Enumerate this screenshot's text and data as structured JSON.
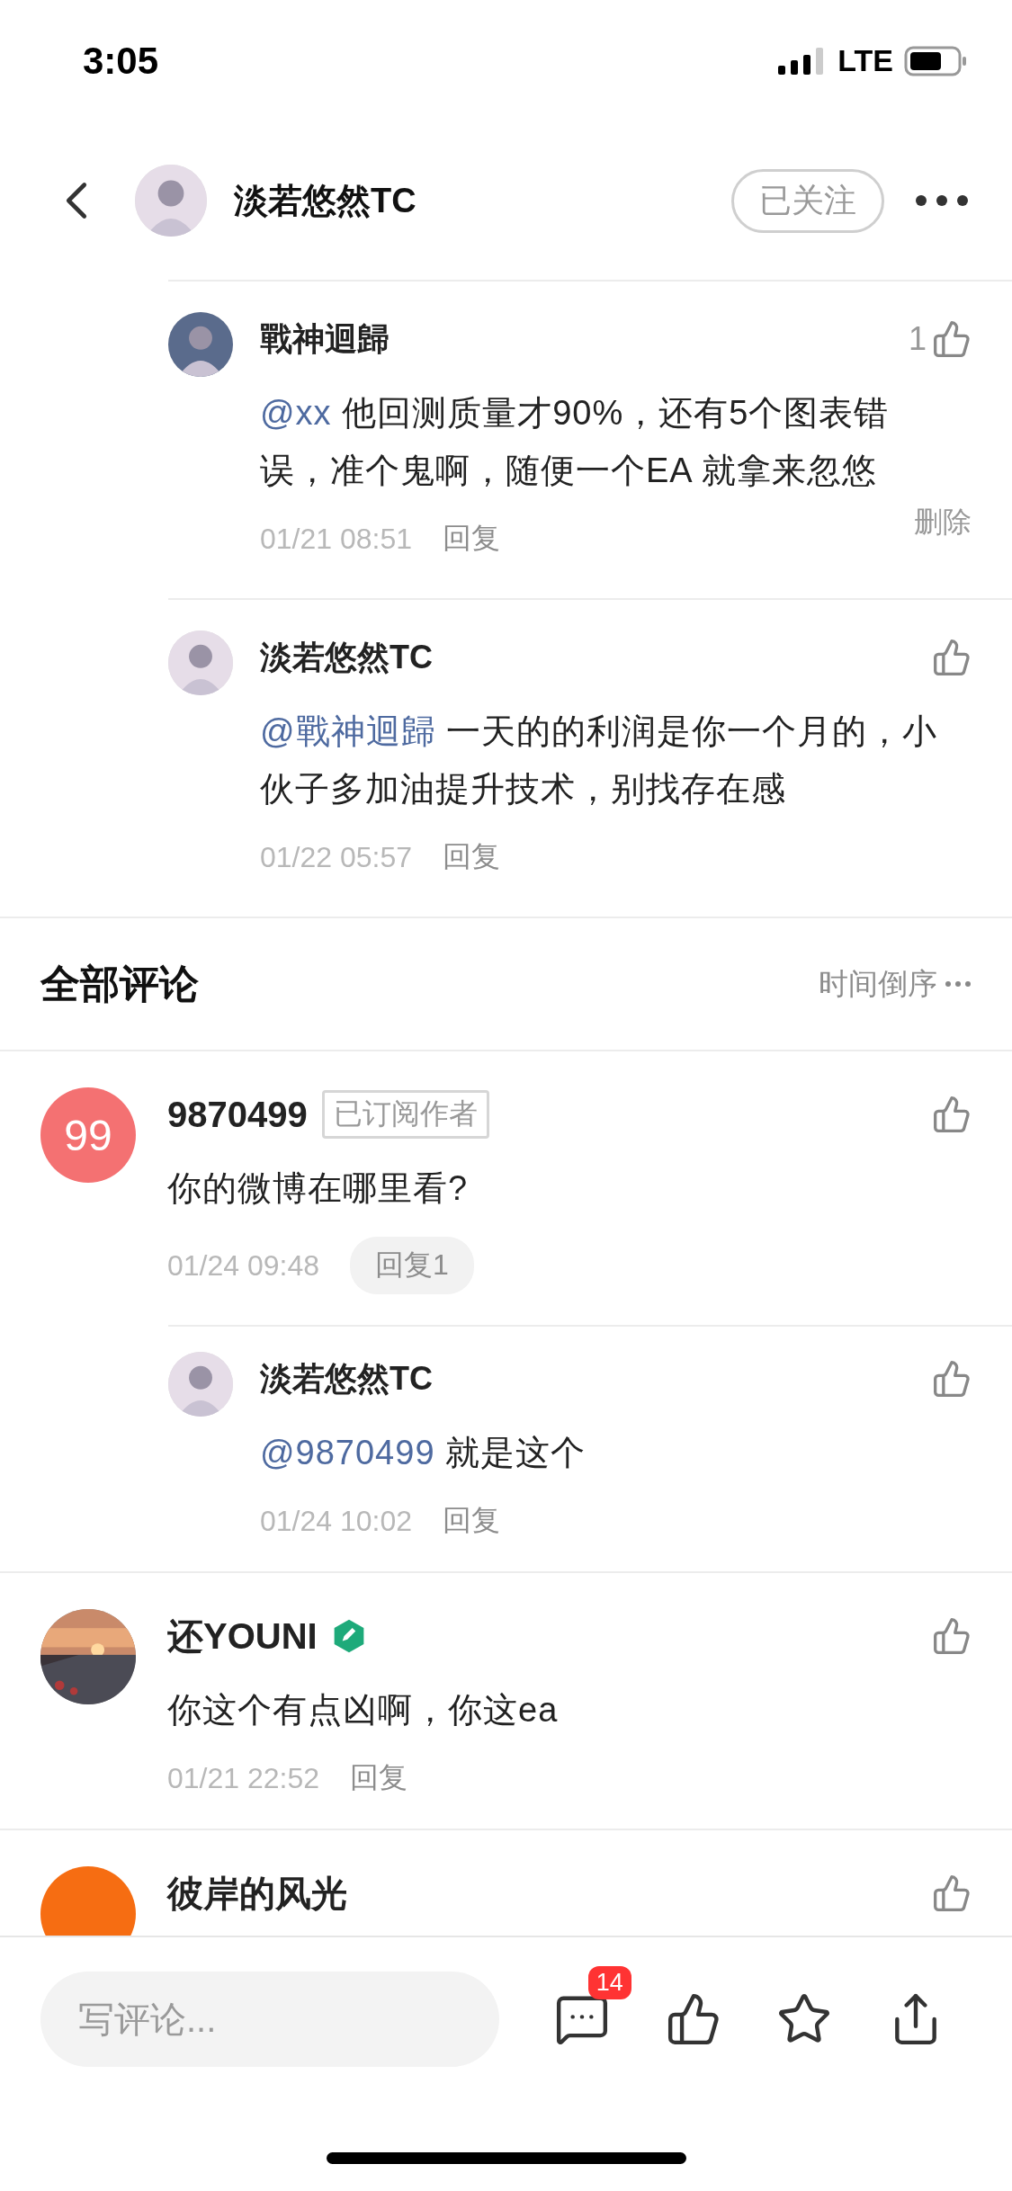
{
  "status_bar": {
    "time": "3:05",
    "network": "LTE"
  },
  "header": {
    "title": "淡若悠然TC",
    "avatar": {
      "kind": "figure"
    },
    "follow_button": {
      "label": "已关注",
      "selected": true
    }
  },
  "replies": [
    {
      "author": "戰神迴歸",
      "avatar": {
        "kind": "figure",
        "color": "#5a6b8c"
      },
      "mention": "@xx",
      "text": "他回测质量才90%，还有5个图表错误，准个鬼啊，随便一个EA 就拿来忽悠",
      "likes": "1",
      "time": "01/21 08:51",
      "reply": "回复",
      "delete": "删除"
    },
    {
      "author": "淡若悠然TC",
      "avatar": {
        "kind": "figure",
        "color": "#e6dde8"
      },
      "mention": "@戰神迴歸",
      "text": "一天的的利润是你一个月的，小伙子多加油提升技术，别找存在感",
      "time": "01/22 05:57",
      "reply": "回复"
    }
  ],
  "comments_section": {
    "title": "全部评论",
    "sort": "时间倒序"
  },
  "comments": [
    {
      "author": "9870499",
      "avatar": {
        "kind": "initials",
        "text": "99",
        "color": "#f47172"
      },
      "badge": "已订阅作者",
      "text": "你的微博在哪里看?",
      "time": "01/24 09:48",
      "reply": "回复1",
      "children": [
        {
          "author": "淡若悠然TC",
          "avatar": {
            "kind": "figure",
            "color": "#e6dde8"
          },
          "mention": "@9870499",
          "text": "就是这个",
          "time": "01/24 10:02",
          "reply": "回复"
        }
      ]
    },
    {
      "author": "还YOUNI",
      "verified": true,
      "text": "你这个有点凶啊，你这ea",
      "time": "01/21 22:52",
      "reply": "回复"
    },
    {
      "author": "彼岸的风光",
      "avatar": {
        "kind": "initials",
        "color": "#f66d12"
      }
    }
  ],
  "composer": {
    "placeholder": "写评论...",
    "comment_count": "14"
  }
}
